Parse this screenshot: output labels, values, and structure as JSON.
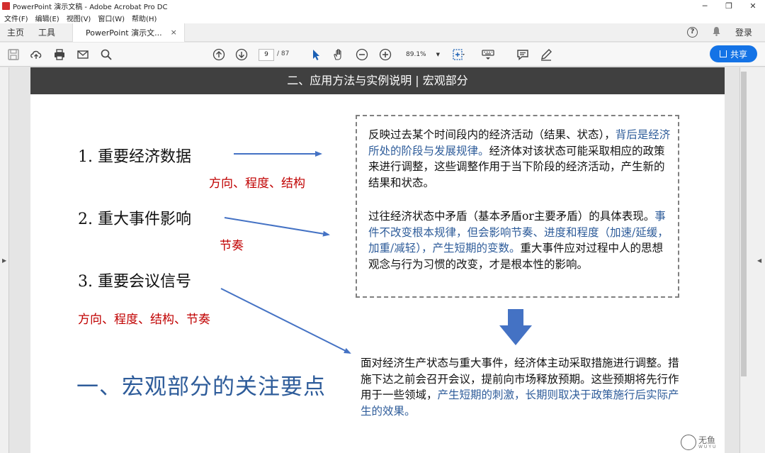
{
  "window": {
    "title": "PowerPoint 演示文稿 - Adobe Acrobat Pro DC",
    "controls": [
      "─",
      "❐",
      "✕"
    ]
  },
  "menubar": {
    "items": [
      "文件(F)",
      "编辑(E)",
      "视图(V)",
      "窗口(W)",
      "帮助(H)"
    ]
  },
  "tabs": {
    "home": "主页",
    "tools": "工具",
    "document": "PowerPoint 演示文...",
    "close": "×",
    "help": "?",
    "login": "登录"
  },
  "toolbar": {
    "page_current": "9",
    "page_total": "/ 87",
    "zoom": "89.1%",
    "share": "共享",
    "icons": [
      "save-icon",
      "upload-icon",
      "print-icon",
      "mail-icon",
      "search-icon",
      "page-up-icon",
      "page-down-icon",
      "select-cursor-icon",
      "hand-tool-icon",
      "zoom-out-icon",
      "zoom-in-icon",
      "fit-page-icon",
      "keyboard-icon",
      "comment-icon",
      "pen-icon"
    ]
  },
  "slide": {
    "header": "二、应用方法与实例说明 | 宏观部分",
    "items": [
      {
        "label": "1.  重要经济数据",
        "sub": "方向、程度、结构"
      },
      {
        "label": "2.  重大事件影响",
        "sub": "节奏"
      },
      {
        "label": "3.  重要会议信号",
        "sub": "方向、程度、结构、节奏"
      }
    ],
    "para1": {
      "a": "反映过去某个时间段内的经济活动（结果、状态），",
      "b": "背后是经济所处的阶段与发展规律。",
      "c": "经济体对该状态可能采取相应的政策来进行调整，这些调整作用于当下阶段的经济活动，产生新的结果和状态。"
    },
    "para2": {
      "a": "过往经济状态中矛盾（基本矛盾or主要矛盾）的具体表现。",
      "b": "事件不改变根本规律，但会影响节奏、进度和程度（加速/延缓，加重/减轻），产生短期的变数。",
      "c": "重大事件应对过程中人的思想观念与行为习惯的改变，才是根本性的影响。"
    },
    "para3": {
      "a": "面对经济生产状态与重大事件，经济体主动采取措施进行调整。措施下达之前会召开会议，提前向市场释放预期。这些预期将先行作用于一些领域，",
      "b": "产生短期的刺激，长期则取决于政策施行后实际产生的效果。"
    },
    "big_title": "一、宏观部分的关注要点",
    "watermark": {
      "text": "无鱼",
      "sub": "WUYU"
    },
    "colors": {
      "header_bg": "#404040",
      "accent_blue": "#2e5c9a",
      "accent_red": "#c00000",
      "arrow": "#4472c4"
    }
  }
}
